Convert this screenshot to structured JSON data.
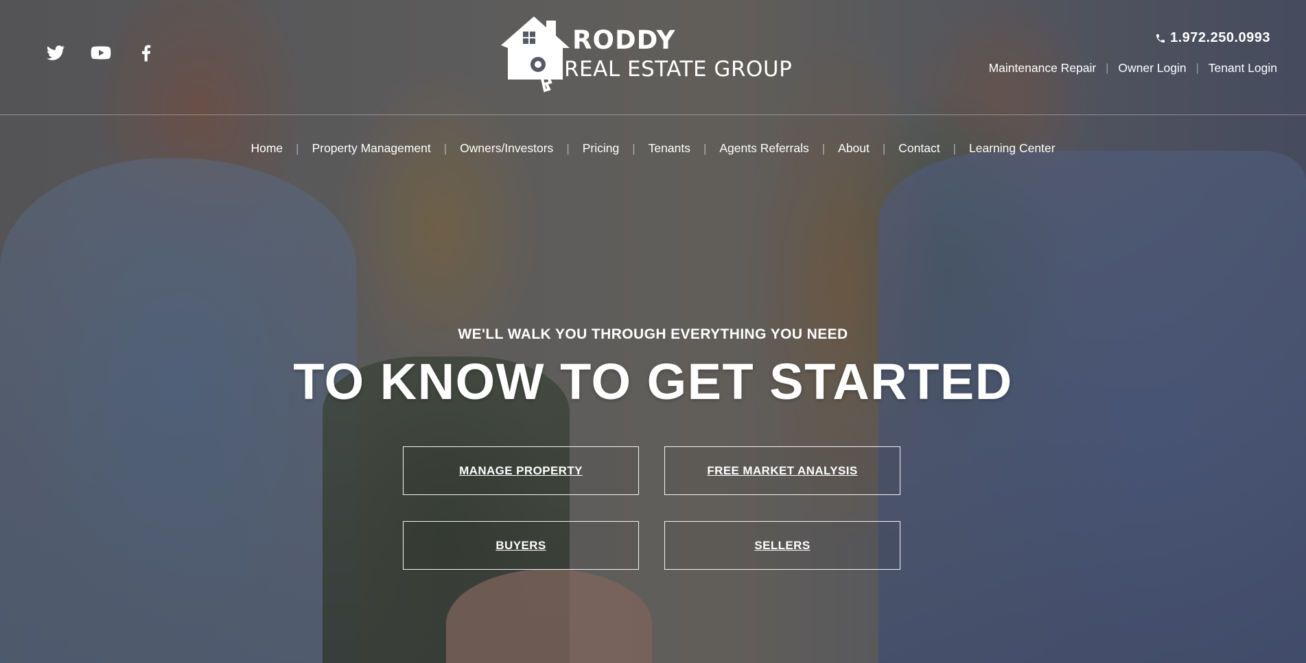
{
  "social": {
    "icons": [
      "twitter-icon",
      "youtube-icon",
      "facebook-icon"
    ]
  },
  "logo": {
    "brand": "RODDY",
    "subtitle": "REAL ESTATE GROUP"
  },
  "contact": {
    "phone_icon": "phone-icon",
    "phone": "1.972.250.0993"
  },
  "toplinks": {
    "maintenance": "Maintenance Repair",
    "owner_login": "Owner Login",
    "tenant_login": "Tenant Login"
  },
  "nav": {
    "items": [
      {
        "label": "Home"
      },
      {
        "label": "Property Management"
      },
      {
        "label": "Owners/Investors"
      },
      {
        "label": "Pricing"
      },
      {
        "label": "Tenants"
      },
      {
        "label": "Agents Referrals"
      },
      {
        "label": "About"
      },
      {
        "label": "Contact"
      },
      {
        "label": "Learning Center"
      }
    ]
  },
  "hero": {
    "eyebrow": "WE'LL WALK YOU THROUGH EVERYTHING YOU NEED",
    "headline": "TO KNOW TO GET STARTED",
    "buttons": [
      {
        "label": "MANAGE PROPERTY"
      },
      {
        "label": "FREE MARKET ANALYSIS"
      },
      {
        "label": "BUYERS"
      },
      {
        "label": "SELLERS"
      }
    ]
  },
  "colors": {
    "text": "#ffffff",
    "overlay": "#1e2430"
  }
}
